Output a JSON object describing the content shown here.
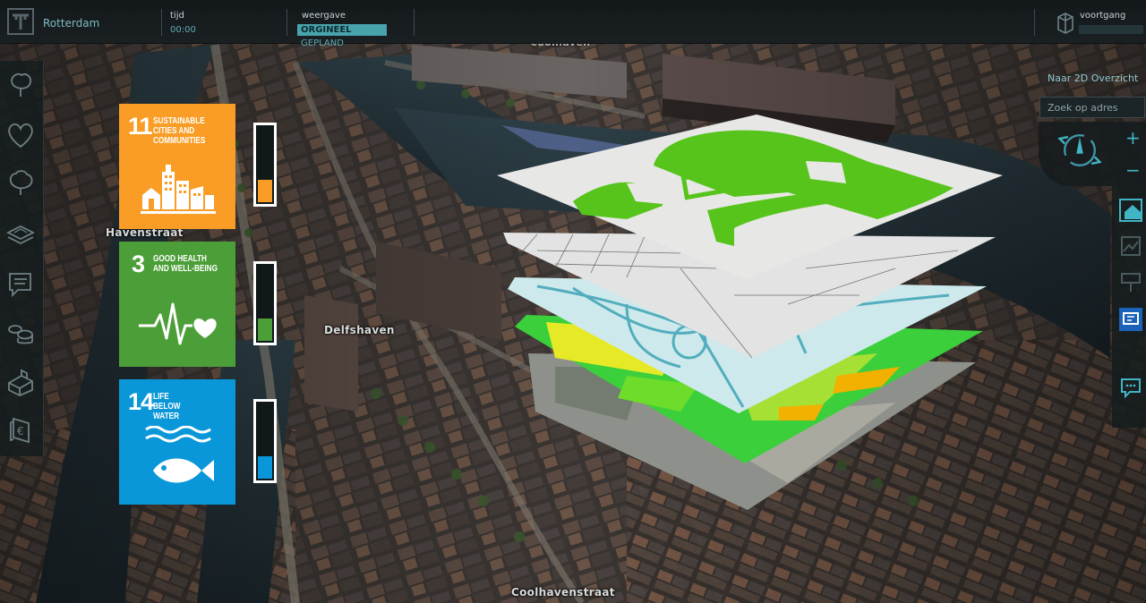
{
  "header": {
    "city": "Rotterdam",
    "time_label": "tijd",
    "time_value": "00:00",
    "view_label": "weergave",
    "view_options": [
      "ORGINEEL",
      "GEPLAND"
    ],
    "progress_label": "voortgang"
  },
  "map": {
    "street_labels": [
      "Havenstraat",
      "Delfshaven",
      "Coolhavenstraat",
      "Coolhaven"
    ]
  },
  "sidebar": {
    "items": [
      {
        "icon": "tree-icon"
      },
      {
        "icon": "heart-icon"
      },
      {
        "icon": "tree-outline-icon"
      },
      {
        "icon": "layers-icon"
      },
      {
        "icon": "chat-icon"
      },
      {
        "icon": "coins-icon"
      },
      {
        "icon": "building-icon"
      },
      {
        "icon": "money-icon"
      }
    ]
  },
  "sdg": [
    {
      "number": "11",
      "title": "SUSTAINABLE CITIES AND COMMUNITIES",
      "color": "#f99d26",
      "icon": "city-icon",
      "level": 0.3
    },
    {
      "number": "3",
      "title": "GOOD HEALTH AND WELL-BEING",
      "color": "#4c9f38",
      "icon": "heartbeat-icon",
      "level": 0.3
    },
    {
      "number": "14",
      "title": "LIFE BELOW WATER",
      "color": "#0a97d9",
      "icon": "fish-icon",
      "level": 0.3
    }
  ],
  "right_panel": {
    "overview_label": "Naar 2D Overzicht",
    "search_placeholder": "Zoek op adres",
    "zoom_in": "+",
    "zoom_out": "−"
  },
  "colors": {
    "accent": "#49a3ad",
    "panel": "#161c1e",
    "map_green": "#59c11e",
    "water": "#233238"
  }
}
